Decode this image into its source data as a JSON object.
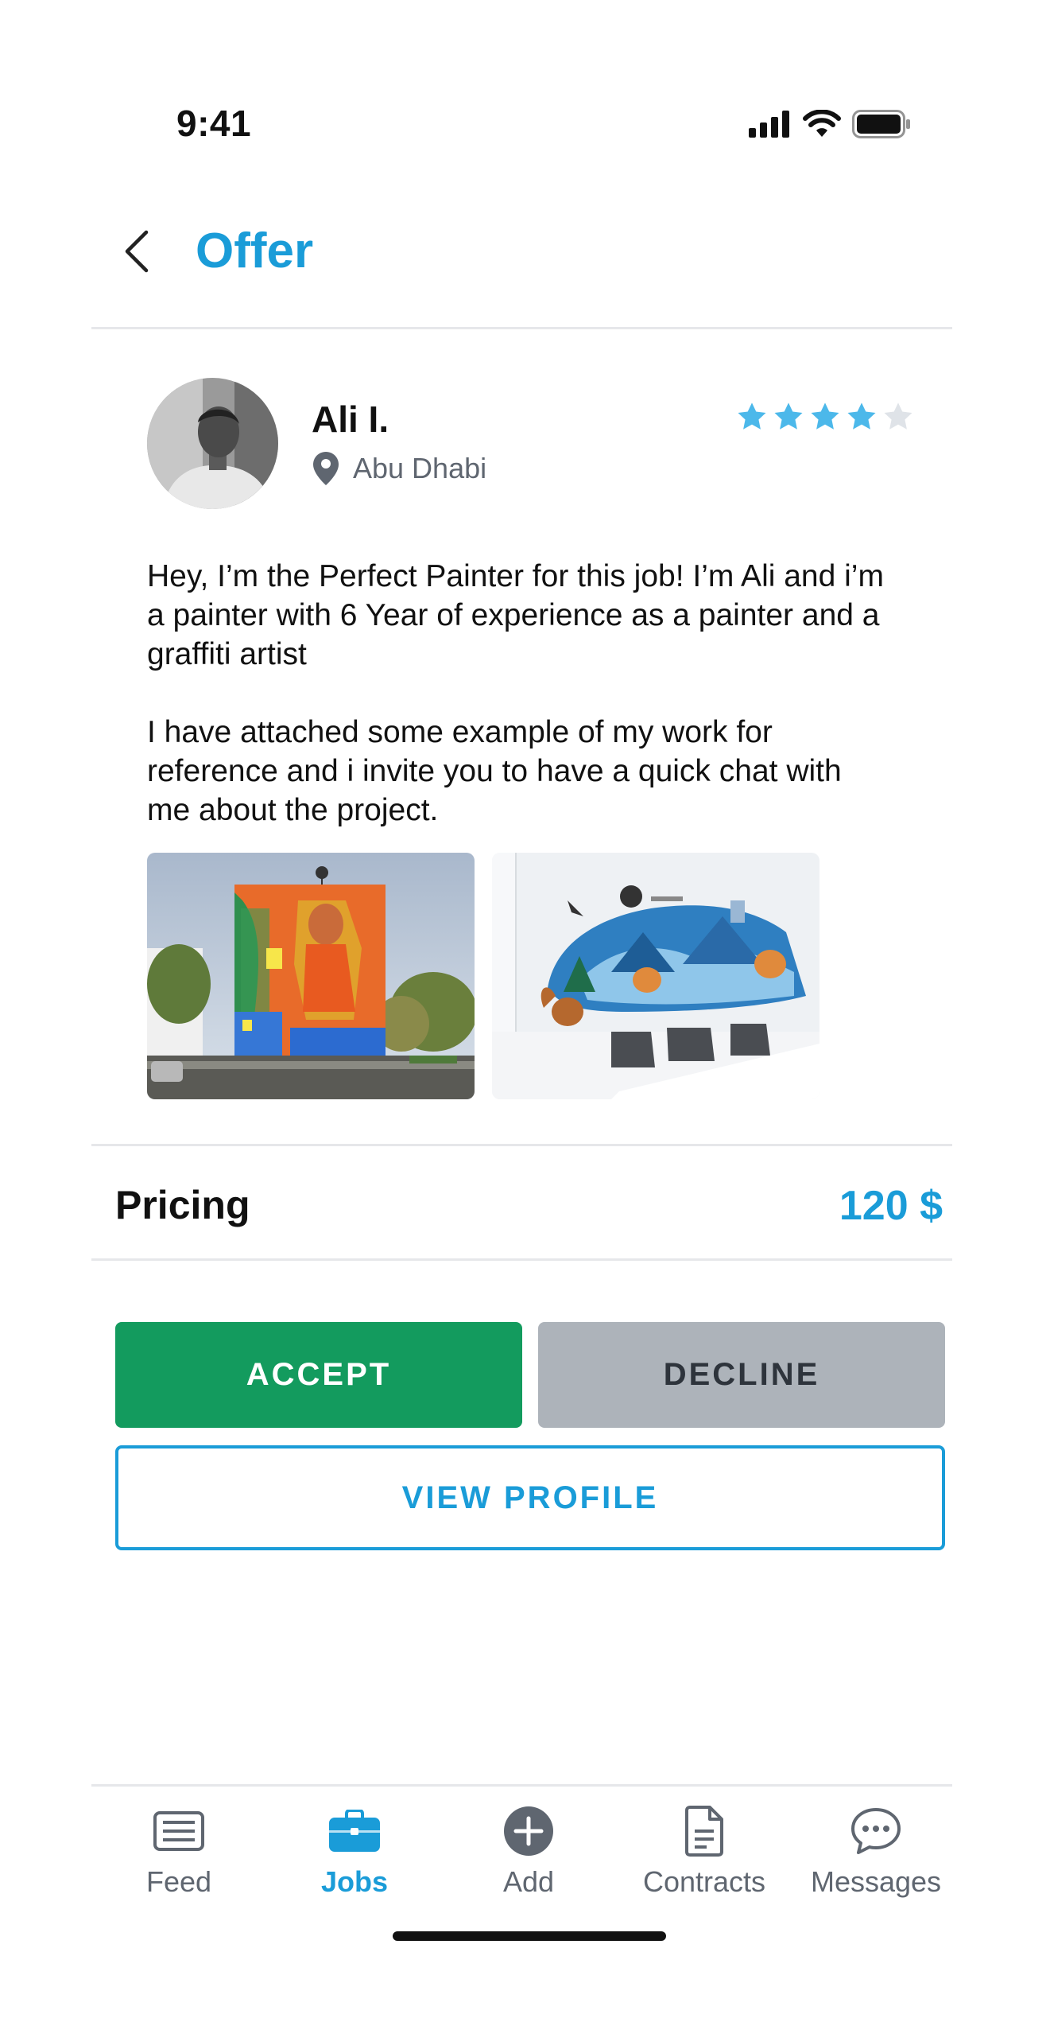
{
  "status_bar": {
    "time": "9:41"
  },
  "header": {
    "title": "Offer"
  },
  "offer": {
    "name": "Ali I.",
    "location": "Abu Dhabi",
    "rating": 4,
    "rating_max": 5,
    "message": [
      "Hey, I’m the Perfect Painter for this job! I’m Ali and i’m a painter with 6 Year of experience as a painter and a graffiti artist",
      "I have attached some example of my work for reference and i invite you to have a quick chat with me about the project."
    ]
  },
  "pricing": {
    "label": "Pricing",
    "value": "120 $"
  },
  "actions": {
    "accept": "ACCEPT",
    "decline": "DECLINE",
    "view_profile": "VIEW PROFILE"
  },
  "tabbar": {
    "tabs": [
      {
        "label": "Feed",
        "icon": "feed-icon"
      },
      {
        "label": "Jobs",
        "icon": "briefcase-icon",
        "active": true
      },
      {
        "label": "Add",
        "icon": "plus-circle-icon"
      },
      {
        "label": "Contracts",
        "icon": "document-icon"
      },
      {
        "label": "Messages",
        "icon": "chat-bubble-icon"
      }
    ]
  },
  "colors": {
    "accent": "#1a9cd8",
    "accept": "#139b5e",
    "decline": "#adb3ba",
    "star_filled": "#4cb8ea",
    "star_empty": "#dfe3e8"
  }
}
